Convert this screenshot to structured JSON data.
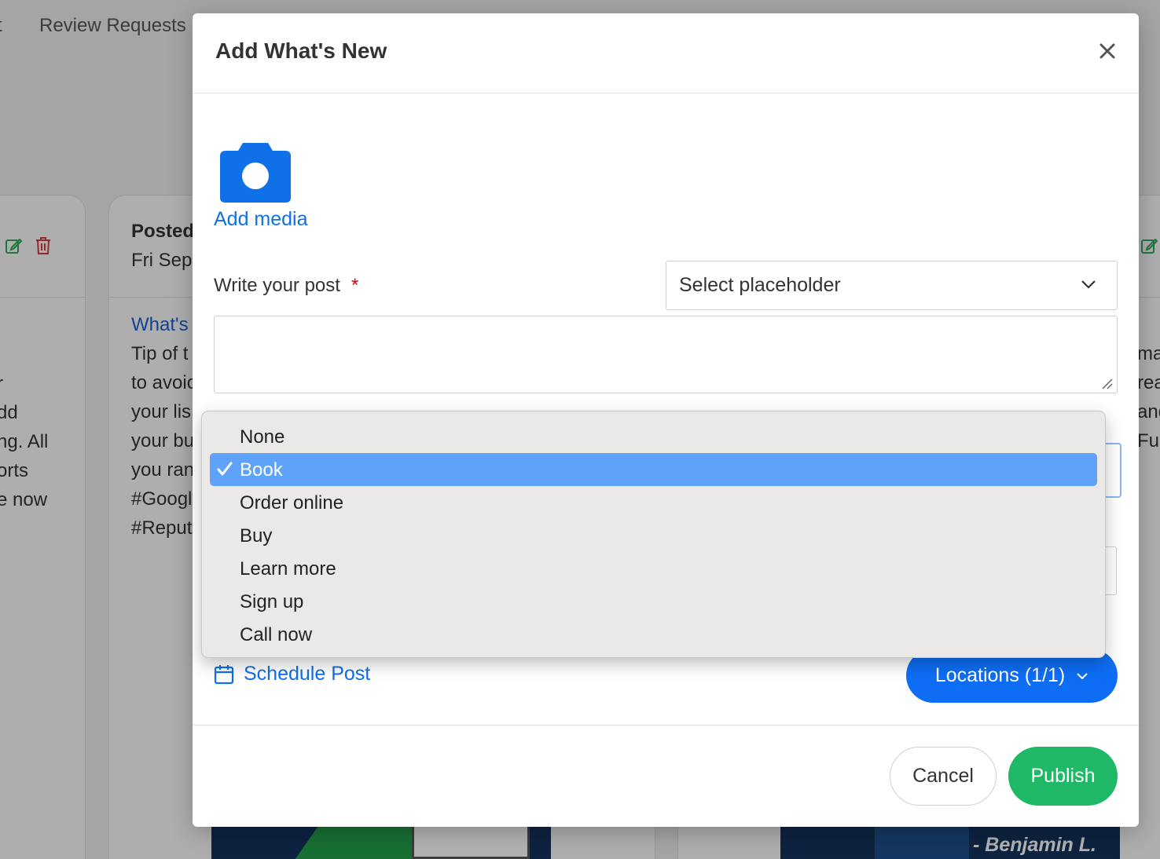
{
  "background": {
    "nav_left_fragment": "t",
    "nav_review_requests": "Review Requests",
    "card_left_lines": [
      "r",
      "dd",
      "ng. All",
      "orts",
      "e now"
    ],
    "card_mid_posted": "Posted",
    "card_mid_date": "Fri Sep",
    "card_mid_link": "What's",
    "card_mid_lines": [
      "Tip of t",
      "to avoic",
      "your lis",
      "your bu",
      "you ran",
      "#Googl",
      "#Reput"
    ],
    "card_right_lines": [
      "ma",
      "rea",
      "and",
      "Fus"
    ],
    "image_caption": "- Benjamin L."
  },
  "modal": {
    "title": "Add What's New",
    "add_media": "Add media",
    "post_label": "Write your post",
    "required_mark": "*",
    "placeholder_select": "Select placeholder",
    "post_text_value": "",
    "schedule_post": "Schedule Post",
    "locations": "Locations (1/1)",
    "cancel": "Cancel",
    "publish": "Publish"
  },
  "dropdown": {
    "options": [
      "None",
      "Book",
      "Order online",
      "Buy",
      "Learn more",
      "Sign up",
      "Call now"
    ],
    "selected": "Book"
  },
  "colors": {
    "accent_blue": "#0d6ef5",
    "link_blue": "#1070e8",
    "publish_green": "#1fb866",
    "required_red": "#d0021b",
    "selected_option": "#5ea2f9",
    "edit_green": "#2eaa55",
    "delete_red": "#d23a3a"
  }
}
